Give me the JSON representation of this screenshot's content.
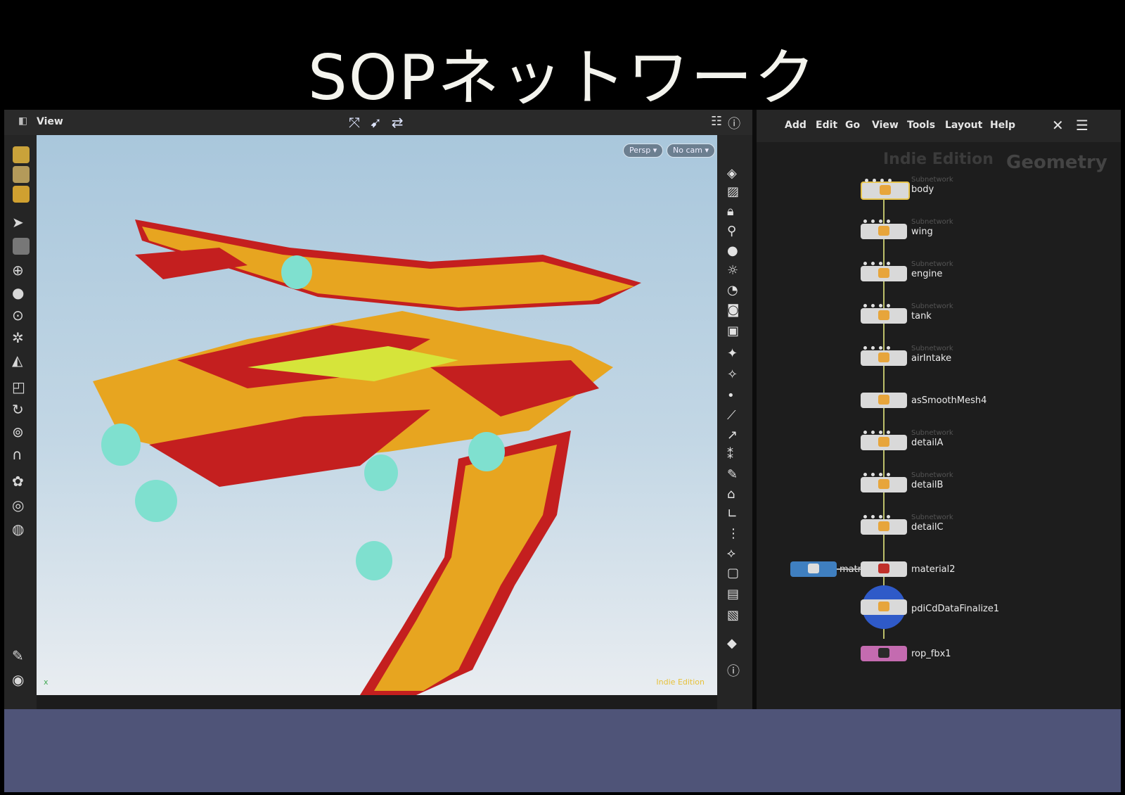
{
  "slide": {
    "title": "SOPネットワーク"
  },
  "viewer": {
    "tab_label": "View",
    "camera_pills": [
      "Persp",
      "No cam"
    ],
    "watermark": "Indie Edition",
    "axis_label": "x"
  },
  "network": {
    "menu": [
      "Add",
      "Edit",
      "Go",
      "View",
      "Tools",
      "Layout",
      "Help"
    ],
    "edition_label": "Indie Edition",
    "context_label": "Geometry",
    "nodes": [
      {
        "type": "Subnetwork",
        "name": "body"
      },
      {
        "type": "Subnetwork",
        "name": "wing"
      },
      {
        "type": "Subnetwork",
        "name": "engine"
      },
      {
        "type": "Subnetwork",
        "name": "tank"
      },
      {
        "type": "Subnetwork",
        "name": "airIntake"
      },
      {
        "type": "",
        "name": "asSmoothMesh4"
      },
      {
        "type": "Subnetwork",
        "name": "detailA"
      },
      {
        "type": "Subnetwork",
        "name": "detailB"
      },
      {
        "type": "Subnetwork",
        "name": "detailC"
      },
      {
        "type": "",
        "name": "material2"
      },
      {
        "type": "",
        "name": "pdiCdDataFinalize1"
      },
      {
        "type": "",
        "name": "rop_fbx1"
      }
    ],
    "side_node_name": "matn"
  },
  "colors": {
    "background": "#000000",
    "pane": "#1d1d1d",
    "selected_outline": "#e8c44a",
    "model_yellow": "#e7a520",
    "model_red": "#c41f1f",
    "model_cyan": "#7fe0cf",
    "bottom_band": "#4f5478"
  }
}
